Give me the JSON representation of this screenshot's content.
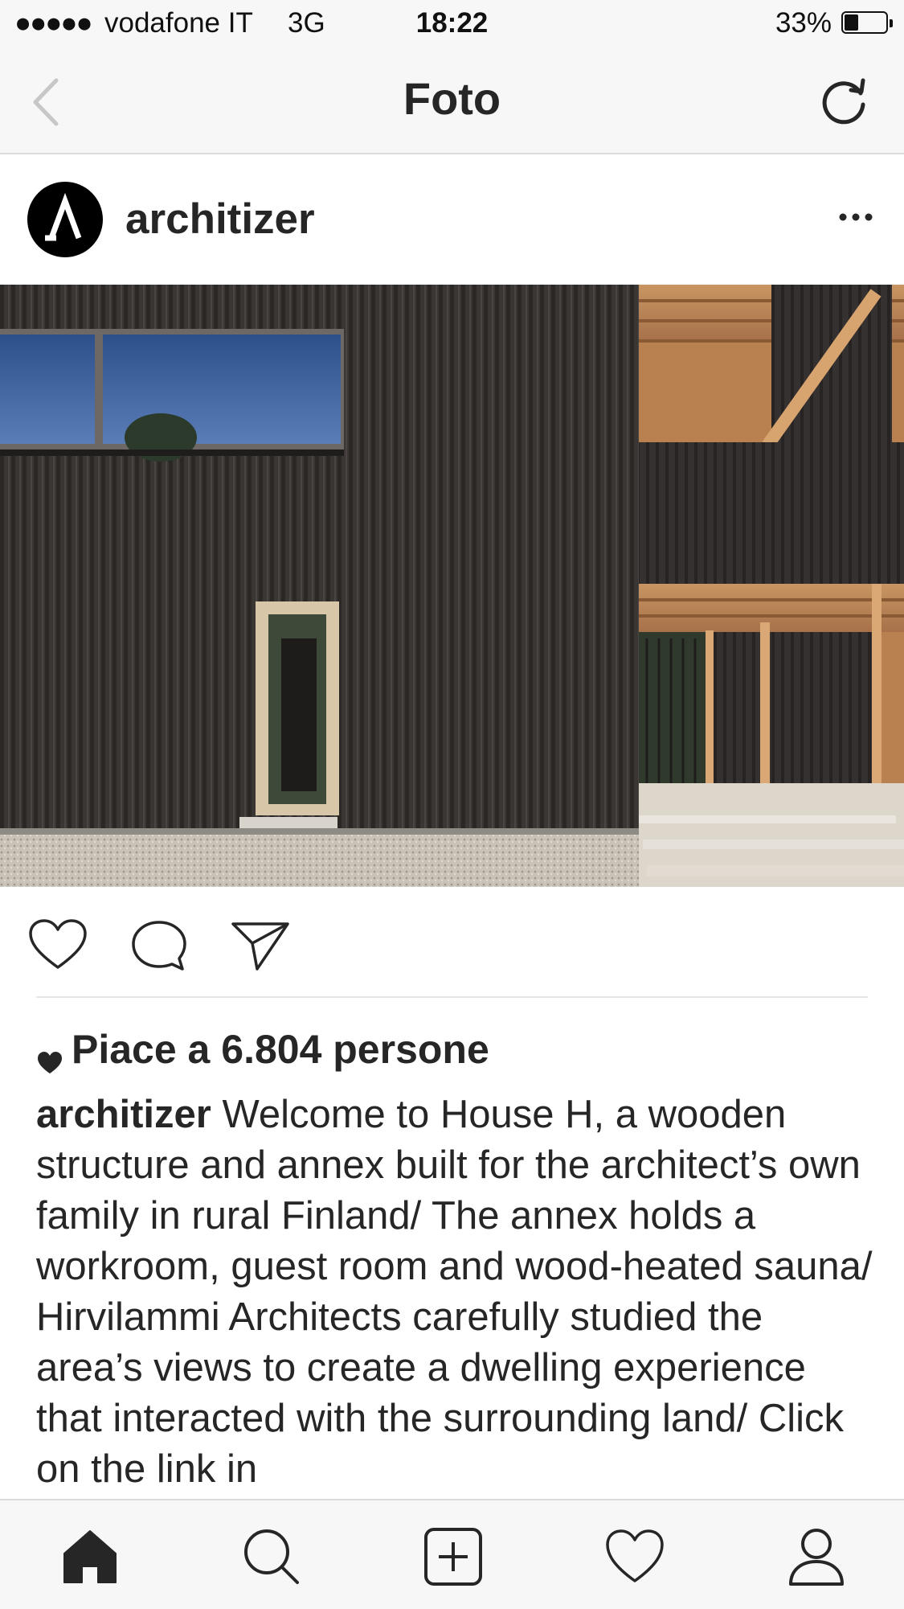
{
  "status_bar": {
    "signal": "●●●●●",
    "carrier": "vodafone IT",
    "network": "3G",
    "time": "18:22",
    "battery_percent": "33%",
    "battery_level": 0.33
  },
  "nav": {
    "title": "Foto",
    "back_icon": "chevron-left-icon",
    "refresh_icon": "refresh-icon"
  },
  "post": {
    "username": "architizer",
    "more_icon": "more-icon",
    "likes_text": "Piace a 6.804 persone",
    "caption_user": "architizer",
    "caption_text": " Welcome to House H, a wooden structure and annex built for the architect’s own family in rural Finland/ The annex holds a workroom, guest room and wood-heated sauna/ Hirvilammi Architects carefully studied the area’s views to create a dwelling experience that interacted with the surrounding land/ Click on the link in"
  },
  "actions": [
    "heart-icon",
    "comment-icon",
    "share-icon"
  ],
  "tab_bar": [
    "home-icon",
    "search-icon",
    "add-post-icon",
    "activity-heart-icon",
    "profile-icon"
  ],
  "colors": {
    "text": "#262626",
    "bar_background": "#f7f7f7",
    "divider": "#dbdbdb"
  }
}
